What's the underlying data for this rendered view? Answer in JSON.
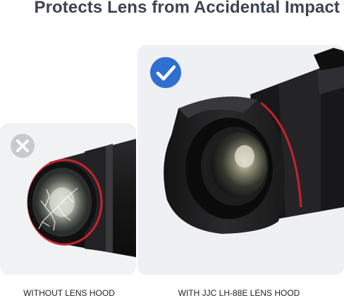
{
  "title": "Protects Lens from Accidental Impact",
  "left_panel": {
    "caption": "WITHOUT LENS HOOD",
    "badge_icon": "x-mark-icon",
    "badge_color": "#c8c9cc"
  },
  "right_panel": {
    "caption": "WITH JJC LH-88E LENS HOOD",
    "badge_icon": "checkmark-icon",
    "badge_color": "#2f6fd0"
  },
  "colors": {
    "title": "#3f4352",
    "panel_bg": "#f1f2f4",
    "lens_ring_red": "#c8232c"
  }
}
